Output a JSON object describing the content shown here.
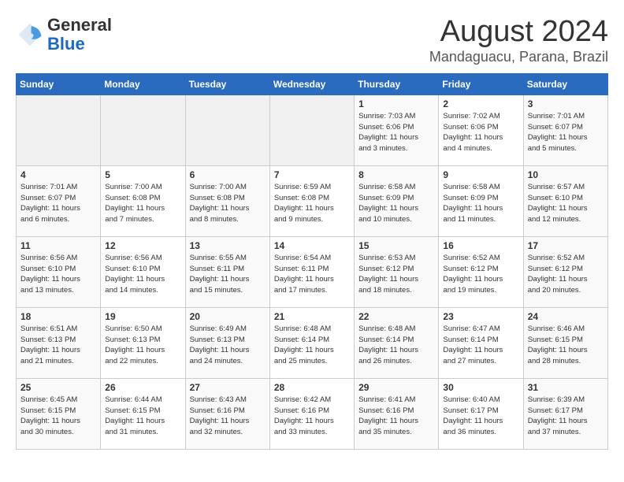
{
  "header": {
    "logo_general": "General",
    "logo_blue": "Blue",
    "month_title": "August 2024",
    "location": "Mandaguacu, Parana, Brazil"
  },
  "weekdays": [
    "Sunday",
    "Monday",
    "Tuesday",
    "Wednesday",
    "Thursday",
    "Friday",
    "Saturday"
  ],
  "weeks": [
    [
      {
        "day": "",
        "info": ""
      },
      {
        "day": "",
        "info": ""
      },
      {
        "day": "",
        "info": ""
      },
      {
        "day": "",
        "info": ""
      },
      {
        "day": "1",
        "info": "Sunrise: 7:03 AM\nSunset: 6:06 PM\nDaylight: 11 hours\nand 3 minutes."
      },
      {
        "day": "2",
        "info": "Sunrise: 7:02 AM\nSunset: 6:06 PM\nDaylight: 11 hours\nand 4 minutes."
      },
      {
        "day": "3",
        "info": "Sunrise: 7:01 AM\nSunset: 6:07 PM\nDaylight: 11 hours\nand 5 minutes."
      }
    ],
    [
      {
        "day": "4",
        "info": "Sunrise: 7:01 AM\nSunset: 6:07 PM\nDaylight: 11 hours\nand 6 minutes."
      },
      {
        "day": "5",
        "info": "Sunrise: 7:00 AM\nSunset: 6:08 PM\nDaylight: 11 hours\nand 7 minutes."
      },
      {
        "day": "6",
        "info": "Sunrise: 7:00 AM\nSunset: 6:08 PM\nDaylight: 11 hours\nand 8 minutes."
      },
      {
        "day": "7",
        "info": "Sunrise: 6:59 AM\nSunset: 6:08 PM\nDaylight: 11 hours\nand 9 minutes."
      },
      {
        "day": "8",
        "info": "Sunrise: 6:58 AM\nSunset: 6:09 PM\nDaylight: 11 hours\nand 10 minutes."
      },
      {
        "day": "9",
        "info": "Sunrise: 6:58 AM\nSunset: 6:09 PM\nDaylight: 11 hours\nand 11 minutes."
      },
      {
        "day": "10",
        "info": "Sunrise: 6:57 AM\nSunset: 6:10 PM\nDaylight: 11 hours\nand 12 minutes."
      }
    ],
    [
      {
        "day": "11",
        "info": "Sunrise: 6:56 AM\nSunset: 6:10 PM\nDaylight: 11 hours\nand 13 minutes."
      },
      {
        "day": "12",
        "info": "Sunrise: 6:56 AM\nSunset: 6:10 PM\nDaylight: 11 hours\nand 14 minutes."
      },
      {
        "day": "13",
        "info": "Sunrise: 6:55 AM\nSunset: 6:11 PM\nDaylight: 11 hours\nand 15 minutes."
      },
      {
        "day": "14",
        "info": "Sunrise: 6:54 AM\nSunset: 6:11 PM\nDaylight: 11 hours\nand 17 minutes."
      },
      {
        "day": "15",
        "info": "Sunrise: 6:53 AM\nSunset: 6:12 PM\nDaylight: 11 hours\nand 18 minutes."
      },
      {
        "day": "16",
        "info": "Sunrise: 6:52 AM\nSunset: 6:12 PM\nDaylight: 11 hours\nand 19 minutes."
      },
      {
        "day": "17",
        "info": "Sunrise: 6:52 AM\nSunset: 6:12 PM\nDaylight: 11 hours\nand 20 minutes."
      }
    ],
    [
      {
        "day": "18",
        "info": "Sunrise: 6:51 AM\nSunset: 6:13 PM\nDaylight: 11 hours\nand 21 minutes."
      },
      {
        "day": "19",
        "info": "Sunrise: 6:50 AM\nSunset: 6:13 PM\nDaylight: 11 hours\nand 22 minutes."
      },
      {
        "day": "20",
        "info": "Sunrise: 6:49 AM\nSunset: 6:13 PM\nDaylight: 11 hours\nand 24 minutes."
      },
      {
        "day": "21",
        "info": "Sunrise: 6:48 AM\nSunset: 6:14 PM\nDaylight: 11 hours\nand 25 minutes."
      },
      {
        "day": "22",
        "info": "Sunrise: 6:48 AM\nSunset: 6:14 PM\nDaylight: 11 hours\nand 26 minutes."
      },
      {
        "day": "23",
        "info": "Sunrise: 6:47 AM\nSunset: 6:14 PM\nDaylight: 11 hours\nand 27 minutes."
      },
      {
        "day": "24",
        "info": "Sunrise: 6:46 AM\nSunset: 6:15 PM\nDaylight: 11 hours\nand 28 minutes."
      }
    ],
    [
      {
        "day": "25",
        "info": "Sunrise: 6:45 AM\nSunset: 6:15 PM\nDaylight: 11 hours\nand 30 minutes."
      },
      {
        "day": "26",
        "info": "Sunrise: 6:44 AM\nSunset: 6:15 PM\nDaylight: 11 hours\nand 31 minutes."
      },
      {
        "day": "27",
        "info": "Sunrise: 6:43 AM\nSunset: 6:16 PM\nDaylight: 11 hours\nand 32 minutes."
      },
      {
        "day": "28",
        "info": "Sunrise: 6:42 AM\nSunset: 6:16 PM\nDaylight: 11 hours\nand 33 minutes."
      },
      {
        "day": "29",
        "info": "Sunrise: 6:41 AM\nSunset: 6:16 PM\nDaylight: 11 hours\nand 35 minutes."
      },
      {
        "day": "30",
        "info": "Sunrise: 6:40 AM\nSunset: 6:17 PM\nDaylight: 11 hours\nand 36 minutes."
      },
      {
        "day": "31",
        "info": "Sunrise: 6:39 AM\nSunset: 6:17 PM\nDaylight: 11 hours\nand 37 minutes."
      }
    ]
  ]
}
